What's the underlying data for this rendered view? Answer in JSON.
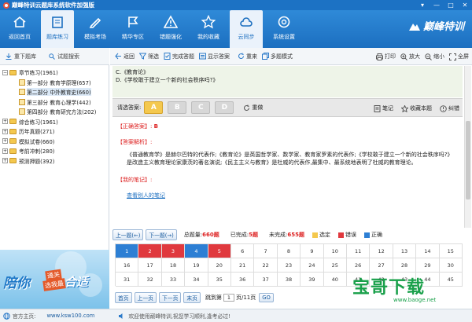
{
  "window": {
    "title": "巅峰特训云题库系统软件加强版",
    "controls": [
      "▾",
      "—",
      "□",
      "✕"
    ]
  },
  "nav": {
    "items": [
      {
        "label": "返回首页",
        "icon": "home-icon"
      },
      {
        "label": "题库练习",
        "icon": "book-icon",
        "active": true
      },
      {
        "label": "模拟考场",
        "icon": "pen-icon"
      },
      {
        "label": "精华专区",
        "icon": "flag-icon"
      },
      {
        "label": "错题强化",
        "icon": "warning-icon"
      },
      {
        "label": "我的收藏",
        "icon": "star-icon"
      },
      {
        "label": "云同步",
        "icon": "cloud-icon",
        "active": true
      },
      {
        "label": "系统设置",
        "icon": "settings-icon"
      }
    ],
    "brand": "巅峰特训"
  },
  "left_toolbar": {
    "download": "重下题库",
    "search": "试题搜索"
  },
  "tree": [
    {
      "label": "章节练习(1961)",
      "level": 0,
      "expanded": true
    },
    {
      "label": "第一部分  教育学原理(657)",
      "level": 1
    },
    {
      "label": "第二部分  中外教育史(660)",
      "level": 1,
      "selected": true
    },
    {
      "label": "第三部分  教育心理学(442)",
      "level": 1
    },
    {
      "label": "第四部分  教育研究方法(202)",
      "level": 1
    },
    {
      "label": "综合练习(1961)",
      "level": 0
    },
    {
      "label": "历年真题(271)",
      "level": 0
    },
    {
      "label": "模拟试卷(660)",
      "level": 0
    },
    {
      "label": "考前冲刺(280)",
      "level": 0
    },
    {
      "label": "预测押题(392)",
      "level": 0
    }
  ],
  "ad": {
    "p1": "陪你",
    "p2": "通关",
    "p3": "选我最",
    "p4": "合适"
  },
  "toolbar": {
    "back": "返回",
    "filter": "筛选",
    "complete": "完成答题",
    "show_answer": "显示答案",
    "redo": "重来",
    "multi": "多题模式",
    "print": "打印",
    "zoom_in": "放大",
    "zoom_out": "缩小",
    "fullscreen": "全屏"
  },
  "question": {
    "opt_c": "C.《教育论》",
    "opt_d": "D.《学校敢于建立一个新的社会秩序吗?》"
  },
  "answer_bar": {
    "label": "请选答案:",
    "options": [
      "A",
      "B",
      "C",
      "D"
    ],
    "selected": "A",
    "redo": "重做",
    "note": "笔记",
    "favorite": "收藏本题",
    "report": "纠错"
  },
  "analysis": {
    "correct_label": "【正确答案】:",
    "correct_value": "B",
    "analysis_label": "【答案解析】:",
    "analysis_text": "《普通教育学》是赫尔巴特的代表作;《教育论》是英国哲学家、数学家、教育家罗素的代表作;《学校敢于建立一个新的社会秩序吗?》是改造主义教育理论家康茨的著名演说;《民主主义与教育》是杜威的代表作,最集中、最系统地表明了杜威的教育理论。",
    "notes_label": "【我的笔记】:",
    "others_link": "查看别人的笔记"
  },
  "navrow": {
    "prev": "上一题(←)",
    "next": "下一题(→)",
    "total_label": "总题量:",
    "total": "660题",
    "done_label": "已完成:",
    "done": "5题",
    "undone_label": "未完成:",
    "undone": "655题",
    "legend": [
      {
        "label": "选定",
        "color": "#f4c84e"
      },
      {
        "label": "错误",
        "color": "#e0393e"
      },
      {
        "label": "正确",
        "color": "#2d7fd4"
      }
    ]
  },
  "grid": {
    "numbers": [
      "1",
      "2",
      "3",
      "4",
      "5",
      "6",
      "7",
      "8",
      "9",
      "10",
      "11",
      "12",
      "13",
      "14",
      "15",
      "16",
      "17",
      "18",
      "19",
      "20",
      "21",
      "22",
      "23",
      "24",
      "25",
      "26",
      "27",
      "28",
      "29",
      "30",
      "31",
      "32",
      "33",
      "34",
      "35",
      "36",
      "37",
      "38",
      "39",
      "40",
      "41",
      "42",
      "43",
      "44",
      "45"
    ],
    "states": [
      "done",
      "wrong",
      "wrong",
      "done",
      "wrong"
    ]
  },
  "pager": {
    "first": "首页",
    "prev": "上一页",
    "next": "下一页",
    "last": "末页",
    "jump_label": "跳到第",
    "page_value": "1",
    "page_suffix": "页/11页",
    "go": "GO"
  },
  "status": {
    "home_label": "官方主页:",
    "home_url": "www.ksw100.com",
    "welcome": "欢迎使用巅峰特训,祝您学习顺利,逢考必过!"
  },
  "watermark": {
    "big": "宝哥下载",
    "small": "www.baoge.net"
  },
  "colors": {
    "nav_blue": "#1c72c4",
    "wrong_red": "#e0393e",
    "done_blue": "#2d7fd4",
    "selected_yellow": "#f4c84e"
  }
}
